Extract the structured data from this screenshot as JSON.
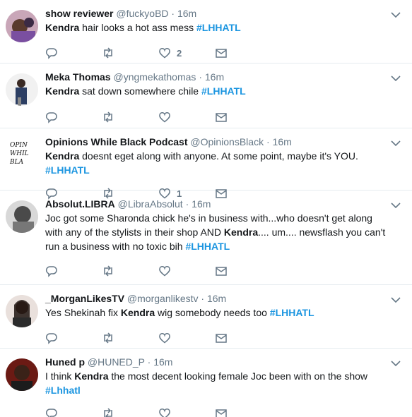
{
  "tweets": [
    {
      "name": "show reviewer",
      "handle": "@fuckyoBD",
      "time": "16m",
      "text_pre": "",
      "bold": "Kendra",
      "text_post": " hair looks a hot ass mess ",
      "hashtag": "#LHHATL",
      "likes": "2"
    },
    {
      "name": "Meka Thomas",
      "handle": "@yngmekathomas",
      "time": "16m",
      "text_pre": "",
      "bold": "Kendra",
      "text_post": " sat down somewhere chile  ",
      "hashtag": "#LHHATL",
      "likes": ""
    },
    {
      "name": "Opinions While Black Podcast",
      "handle": "@OpinionsBlack",
      "time": "16m",
      "text_pre": "",
      "bold": "Kendra",
      "text_post": " doesnt eget along with anyone. At some point, maybe it's YOU. ",
      "hashtag": "#LHHATL",
      "likes": "1",
      "avatar_text": "OPIN WHIL BLA"
    },
    {
      "name": "Absolut.LIBRA",
      "handle": "@LibraAbsolut",
      "time": "16m",
      "text_pre": "Joc got some Sharonda chick he's in business with...who doesn't get along with any of the stylists in their shop AND ",
      "bold": "Kendra",
      "text_post": ".... um.... newsflash you can't run a business with no toxic bih  ",
      "hashtag": "#LHHATL",
      "likes": ""
    },
    {
      "name": "_MorganLikesTV",
      "handle": "@morganlikestv",
      "time": "16m",
      "text_pre": "Yes Shekinah fix ",
      "bold": "Kendra",
      "text_post": " wig somebody needs too ",
      "hashtag": "#LHHATL",
      "likes": ""
    },
    {
      "name": "Huned p",
      "handle": "@HUNED_P",
      "time": "16m",
      "text_pre": "I think ",
      "bold": "Kendra",
      "text_post": " the most decent looking female Joc been with on the show ",
      "hashtag": "#Lhhatl",
      "likes": ""
    }
  ],
  "colors": {
    "accent": "#1b95e0",
    "muted": "#657786",
    "divider": "#e6ecf0"
  },
  "icons": [
    "reply-icon",
    "retweet-icon",
    "like-icon",
    "message-icon",
    "chevron-down-icon"
  ]
}
